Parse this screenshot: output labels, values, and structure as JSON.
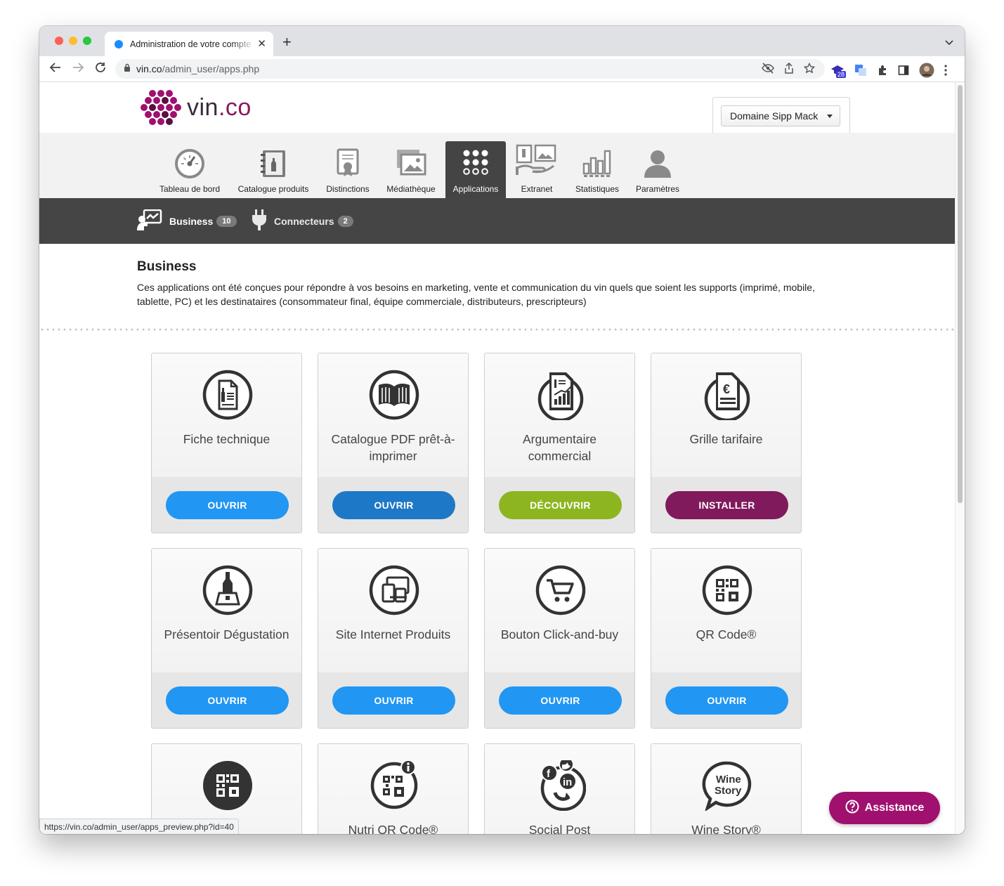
{
  "browser": {
    "tab_title": "Administration de votre compte",
    "url_host": "vin.co",
    "url_path": "/admin_user/apps.php",
    "extension_badge": "28"
  },
  "site": {
    "logo_text_main": "vin",
    "logo_text_accent": ".co",
    "account_name": "Domaine Sipp Mack"
  },
  "mainnav": {
    "items": [
      {
        "label": "Tableau de bord",
        "icon": "dashboard-gauge-icon"
      },
      {
        "label": "Catalogue produits",
        "icon": "catalog-binder-icon"
      },
      {
        "label": "Distinctions",
        "icon": "award-certificate-icon"
      },
      {
        "label": "Médiathèque",
        "icon": "media-images-icon"
      },
      {
        "label": "Applications",
        "icon": "apps-grid-icon",
        "active": true
      },
      {
        "label": "Extranet",
        "icon": "extranet-hand-icon"
      },
      {
        "label": "Statistiques",
        "icon": "bar-chart-icon"
      },
      {
        "label": "Paramètres",
        "icon": "user-settings-icon"
      }
    ]
  },
  "subnav": {
    "business_label": "Business",
    "business_count": "10",
    "connectors_label": "Connecteurs",
    "connectors_count": "2"
  },
  "section": {
    "title": "Business",
    "description": "Ces applications ont été conçues pour répondre à vos besoins en marketing, vente et communication du vin quels que soient les supports (imprimé, mobile, tablette, PC) et les destinataires (consommateur final, équipe commerciale, distributeurs, prescripteurs)"
  },
  "apps": [
    {
      "name": "Fiche technique",
      "button": "OUVRIR",
      "color": "#2196f3",
      "icon": "document-icon"
    },
    {
      "name": "Catalogue PDF prêt-à-imprimer",
      "button": "OUVRIR",
      "color": "#1e78c8",
      "icon": "book-icon"
    },
    {
      "name": "Argumentaire commercial",
      "button": "DÉCOUVRIR",
      "color": "#8db51f",
      "icon": "report-chart-icon"
    },
    {
      "name": "Grille tarifaire",
      "button": "INSTALLER",
      "color": "#801a5c",
      "icon": "price-list-icon"
    },
    {
      "name": "Présentoir Dégustation",
      "button": "OUVRIR",
      "color": "#2196f3",
      "icon": "bottle-display-icon"
    },
    {
      "name": "Site Internet Produits",
      "button": "OUVRIR",
      "color": "#2196f3",
      "icon": "devices-icon"
    },
    {
      "name": "Bouton Click-and-buy",
      "button": "OUVRIR",
      "color": "#2196f3",
      "icon": "cart-icon"
    },
    {
      "name": "QR Code®",
      "button": "OUVRIR",
      "color": "#2196f3",
      "icon": "qr-code-icon"
    },
    {
      "name": "",
      "icon": "qr-code-dark-icon"
    },
    {
      "name": "Nutri QR Code®",
      "icon": "nutri-qr-icon"
    },
    {
      "name": "Social Post",
      "icon": "social-post-icon"
    },
    {
      "name": "Wine Story®",
      "icon": "wine-story-icon",
      "icon_text_1": "Wine",
      "icon_text_2": "Story"
    }
  ],
  "assistance_label": "Assistance",
  "status_url": "https://vin.co/admin_user/apps_preview.php?id=40"
}
